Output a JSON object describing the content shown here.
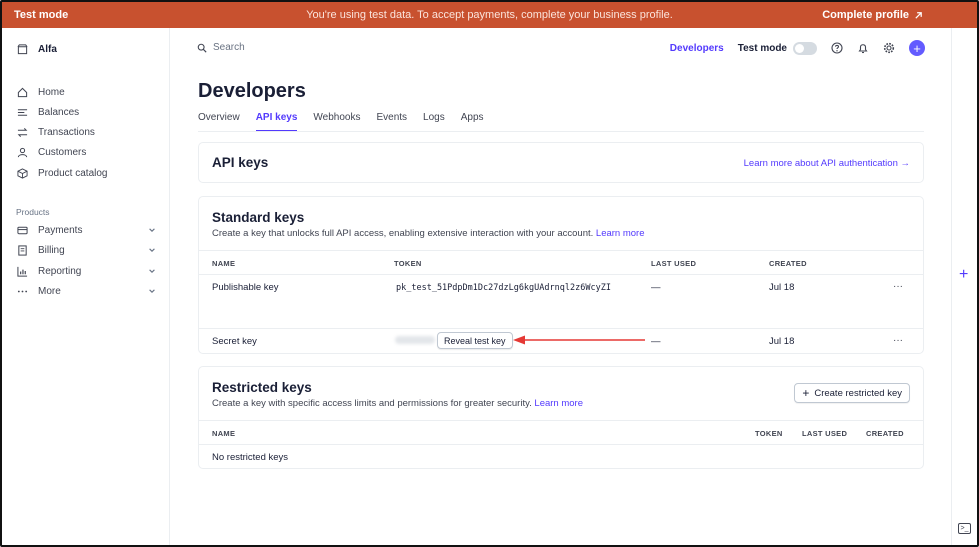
{
  "banner": {
    "mode_label": "Test mode",
    "message": "You're using test data. To accept payments, complete your business profile.",
    "cta_label": "Complete profile",
    "cta_icon": "arrow-up-right-icon",
    "color": "#c8512f"
  },
  "sidebar": {
    "account": "Alfa",
    "items": [
      {
        "label": "Home",
        "icon": "home-icon"
      },
      {
        "label": "Balances",
        "icon": "balances-icon"
      },
      {
        "label": "Transactions",
        "icon": "transactions-icon"
      },
      {
        "label": "Customers",
        "icon": "customer-icon"
      },
      {
        "label": "Product catalog",
        "icon": "box-icon"
      }
    ],
    "section_label": "Products",
    "product_items": [
      {
        "label": "Payments",
        "icon": "card-icon"
      },
      {
        "label": "Billing",
        "icon": "billing-icon"
      },
      {
        "label": "Reporting",
        "icon": "chart-icon"
      },
      {
        "label": "More",
        "icon": "ellipsis-icon"
      }
    ]
  },
  "header": {
    "search_placeholder": "Search",
    "developers_link": "Developers",
    "test_mode_label": "Test mode",
    "test_mode_on": false
  },
  "page": {
    "title": "Developers",
    "tabs": [
      "Overview",
      "API keys",
      "Webhooks",
      "Events",
      "Logs",
      "Apps"
    ],
    "active_tab": "API keys"
  },
  "api_keys_card": {
    "title": "API keys",
    "link": "Learn more about API authentication →"
  },
  "standard_keys": {
    "title": "Standard keys",
    "subtitle": "Create a key that unlocks full API access, enabling extensive interaction with your account.",
    "learn_more": "Learn more",
    "columns": [
      "NAME",
      "TOKEN",
      "LAST USED",
      "CREATED"
    ],
    "rows": [
      {
        "name": "Publishable key",
        "token": "pk_test_51PdpDm1Dc27dzLg6kgUAdrnql2z6WcyZI",
        "last_used": "—",
        "created": "Jul 18",
        "more": "···"
      },
      {
        "name": "Secret key",
        "token_button": "Reveal test key",
        "last_used": "—",
        "created": "Jul 18",
        "more": "···"
      }
    ]
  },
  "restricted_keys": {
    "title": "Restricted keys",
    "subtitle": "Create a key with specific access limits and permissions for greater security.",
    "learn_more": "Learn more",
    "create_button": "Create restricted key",
    "columns": [
      "NAME",
      "TOKEN",
      "LAST USED",
      "CREATED"
    ],
    "empty_text": "No restricted keys"
  },
  "annotation": {
    "arrow_color": "#e53935"
  }
}
